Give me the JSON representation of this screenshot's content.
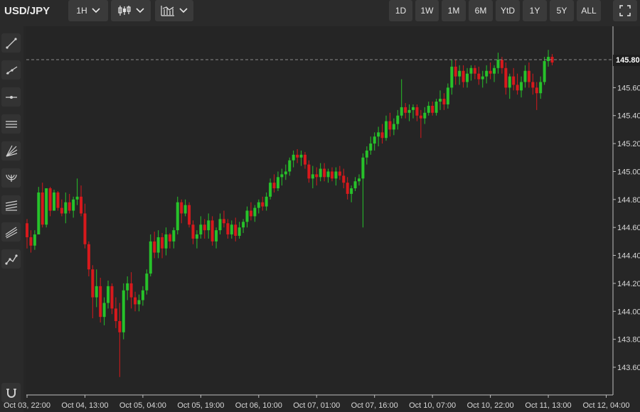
{
  "header": {
    "symbol": "USD/JPY",
    "interval": "1H",
    "ranges": [
      "1D",
      "1W",
      "1M",
      "6M",
      "YtD",
      "1Y",
      "5Y",
      "ALL"
    ]
  },
  "icons": {
    "chart_type": "candlestick-icon",
    "indicators": "indicators-icon",
    "fullscreen": "fullscreen-icon",
    "tools": [
      "trend-line-icon",
      "ray-icon",
      "horizontal-line-icon",
      "parallel-channel-icon",
      "fan-icon",
      "arc-icon",
      "fibonacci-icon",
      "pitchfork-icon",
      "path-icon",
      "magnet-icon"
    ]
  },
  "colors": {
    "up": "#27c22a",
    "down": "#d7191c",
    "background": "#252525"
  },
  "chart_data": {
    "type": "candlestick",
    "symbol": "USD/JPY",
    "y_ticks": [
      "145.80",
      "145.60",
      "145.40",
      "145.20",
      "145.00",
      "144.80",
      "144.60",
      "144.40",
      "144.20",
      "144.00",
      "143.80",
      "143.60"
    ],
    "ylim": [
      143.52,
      146.0
    ],
    "x_tick_labels": [
      "Oct 03, 22:00",
      "Oct 04, 13:00",
      "Oct 05, 04:00",
      "Oct 05, 19:00",
      "Oct 06, 10:00",
      "Oct 07, 01:00",
      "Oct 07, 16:00",
      "Oct 10, 07:00",
      "Oct 10, 22:00",
      "Oct 11, 13:00",
      "Oct 12, 04:00"
    ],
    "x_tick_candle_index": [
      0,
      15,
      30,
      45,
      60,
      75,
      90,
      105,
      120,
      135,
      150
    ],
    "last_price": "145.80",
    "grid": false,
    "candles": [
      [
        144.63,
        144.66,
        144.45,
        144.53
      ],
      [
        144.53,
        144.58,
        144.42,
        144.47
      ],
      [
        144.47,
        144.58,
        144.44,
        144.55
      ],
      [
        144.55,
        144.89,
        144.55,
        144.85
      ],
      [
        144.85,
        144.92,
        144.6,
        144.62
      ],
      [
        144.62,
        144.88,
        144.6,
        144.88
      ],
      [
        144.88,
        144.89,
        144.68,
        144.72
      ],
      [
        144.72,
        144.87,
        144.72,
        144.85
      ],
      [
        144.85,
        144.86,
        144.72,
        144.74
      ],
      [
        144.74,
        144.8,
        144.68,
        144.7
      ],
      [
        144.7,
        144.85,
        144.63,
        144.78
      ],
      [
        144.78,
        144.84,
        144.7,
        144.72
      ],
      [
        144.72,
        144.82,
        144.67,
        144.8
      ],
      [
        144.8,
        144.95,
        144.76,
        144.82
      ],
      [
        144.82,
        144.9,
        144.68,
        144.7
      ],
      [
        144.7,
        144.77,
        144.45,
        144.48
      ],
      [
        144.48,
        144.5,
        144.25,
        144.3
      ],
      [
        144.3,
        144.33,
        143.95,
        144.1
      ],
      [
        144.1,
        144.3,
        144.03,
        144.18
      ],
      [
        144.18,
        144.24,
        143.92,
        143.96
      ],
      [
        143.96,
        144.1,
        143.9,
        144.06
      ],
      [
        144.06,
        144.22,
        144.02,
        144.18
      ],
      [
        144.18,
        144.2,
        143.98,
        144.02
      ],
      [
        144.02,
        144.1,
        143.88,
        143.93
      ],
      [
        143.93,
        144.06,
        143.53,
        143.85
      ],
      [
        143.85,
        144.2,
        143.8,
        144.15
      ],
      [
        144.15,
        144.25,
        144.08,
        144.2
      ],
      [
        144.2,
        144.28,
        144.02,
        144.1
      ],
      [
        144.1,
        144.14,
        144.0,
        144.05
      ],
      [
        144.05,
        144.12,
        144.0,
        144.08
      ],
      [
        144.08,
        144.18,
        144.04,
        144.15
      ],
      [
        144.15,
        144.3,
        144.12,
        144.27
      ],
      [
        144.27,
        144.55,
        144.25,
        144.5
      ],
      [
        144.5,
        144.57,
        144.38,
        144.42
      ],
      [
        144.42,
        144.58,
        144.38,
        144.53
      ],
      [
        144.53,
        144.56,
        144.38,
        144.45
      ],
      [
        144.45,
        144.6,
        144.4,
        144.55
      ],
      [
        144.55,
        144.56,
        144.45,
        144.5
      ],
      [
        144.5,
        144.6,
        144.45,
        144.58
      ],
      [
        144.58,
        144.82,
        144.55,
        144.78
      ],
      [
        144.78,
        144.8,
        144.63,
        144.7
      ],
      [
        144.7,
        144.8,
        144.68,
        144.76
      ],
      [
        144.76,
        144.78,
        144.6,
        144.62
      ],
      [
        144.62,
        144.65,
        144.48,
        144.52
      ],
      [
        144.52,
        144.58,
        144.45,
        144.55
      ],
      [
        144.55,
        144.68,
        144.52,
        144.62
      ],
      [
        144.62,
        144.66,
        144.52,
        144.58
      ],
      [
        144.58,
        144.7,
        144.52,
        144.65
      ],
      [
        144.65,
        144.68,
        144.47,
        144.5
      ],
      [
        144.5,
        144.6,
        144.45,
        144.58
      ],
      [
        144.58,
        144.7,
        144.55,
        144.66
      ],
      [
        144.66,
        144.72,
        144.6,
        144.63
      ],
      [
        144.63,
        144.66,
        144.52,
        144.55
      ],
      [
        144.55,
        144.65,
        144.52,
        144.62
      ],
      [
        144.62,
        144.67,
        144.5,
        144.54
      ],
      [
        144.54,
        144.64,
        144.52,
        144.6
      ],
      [
        144.6,
        144.66,
        144.56,
        144.64
      ],
      [
        144.64,
        144.75,
        144.6,
        144.72
      ],
      [
        144.72,
        144.78,
        144.65,
        144.68
      ],
      [
        144.68,
        144.76,
        144.64,
        144.74
      ],
      [
        144.74,
        144.8,
        144.7,
        144.78
      ],
      [
        144.78,
        144.82,
        144.72,
        144.75
      ],
      [
        144.75,
        144.85,
        144.72,
        144.82
      ],
      [
        144.82,
        144.95,
        144.8,
        144.92
      ],
      [
        144.92,
        144.98,
        144.85,
        144.88
      ],
      [
        144.88,
        145.0,
        144.86,
        144.96
      ],
      [
        144.96,
        145.02,
        144.9,
        144.98
      ],
      [
        144.98,
        145.05,
        144.94,
        145.0
      ],
      [
        145.0,
        145.1,
        144.97,
        145.08
      ],
      [
        145.08,
        145.15,
        145.03,
        145.12
      ],
      [
        145.12,
        145.16,
        145.06,
        145.1
      ],
      [
        145.1,
        145.15,
        145.04,
        145.12
      ],
      [
        145.12,
        145.14,
        145.02,
        145.05
      ],
      [
        145.05,
        145.08,
        144.92,
        144.95
      ],
      [
        144.95,
        145.04,
        144.88,
        144.98
      ],
      [
        144.98,
        145.03,
        144.9,
        144.96
      ],
      [
        144.96,
        145.06,
        144.93,
        145.02
      ],
      [
        145.02,
        145.06,
        144.93,
        144.96
      ],
      [
        144.96,
        145.02,
        144.92,
        145.0
      ],
      [
        145.0,
        145.03,
        144.93,
        144.95
      ],
      [
        144.95,
        145.03,
        144.9,
        145.0
      ],
      [
        145.0,
        145.04,
        144.94,
        144.97
      ],
      [
        144.97,
        145.02,
        144.88,
        144.92
      ],
      [
        144.92,
        144.96,
        144.8,
        144.84
      ],
      [
        144.84,
        144.9,
        144.78,
        144.88
      ],
      [
        144.88,
        144.96,
        144.86,
        144.93
      ],
      [
        144.93,
        144.98,
        144.9,
        144.95
      ],
      [
        144.95,
        145.13,
        144.6,
        145.1
      ],
      [
        145.1,
        145.18,
        145.05,
        145.15
      ],
      [
        145.15,
        145.25,
        145.12,
        145.2
      ],
      [
        145.2,
        145.28,
        145.15,
        145.25
      ],
      [
        145.25,
        145.32,
        145.18,
        145.28
      ],
      [
        145.28,
        145.34,
        145.2,
        145.24
      ],
      [
        145.24,
        145.4,
        145.22,
        145.36
      ],
      [
        145.36,
        145.42,
        145.25,
        145.3
      ],
      [
        145.3,
        145.38,
        145.26,
        145.34
      ],
      [
        145.34,
        145.44,
        145.3,
        145.4
      ],
      [
        145.4,
        145.66,
        145.38,
        145.46
      ],
      [
        145.46,
        145.49,
        145.38,
        145.42
      ],
      [
        145.42,
        145.48,
        145.36,
        145.44
      ],
      [
        145.44,
        145.48,
        145.38,
        145.46
      ],
      [
        145.46,
        145.48,
        145.36,
        145.4
      ],
      [
        145.4,
        145.44,
        145.24,
        145.38
      ],
      [
        145.38,
        145.46,
        145.34,
        145.42
      ],
      [
        145.42,
        145.5,
        145.4,
        145.47
      ],
      [
        145.47,
        145.5,
        145.4,
        145.42
      ],
      [
        145.42,
        145.52,
        145.4,
        145.5
      ],
      [
        145.5,
        145.58,
        145.44,
        145.52
      ],
      [
        145.52,
        145.56,
        145.44,
        145.48
      ],
      [
        145.48,
        145.63,
        145.45,
        145.6
      ],
      [
        145.6,
        145.8,
        145.55,
        145.75
      ],
      [
        145.75,
        145.8,
        145.62,
        145.68
      ],
      [
        145.68,
        145.76,
        145.62,
        145.72
      ],
      [
        145.72,
        145.76,
        145.6,
        145.64
      ],
      [
        145.64,
        145.74,
        145.6,
        145.7
      ],
      [
        145.7,
        145.76,
        145.65,
        145.74
      ],
      [
        145.74,
        145.76,
        145.66,
        145.7
      ],
      [
        145.7,
        145.75,
        145.62,
        145.66
      ],
      [
        145.66,
        145.72,
        145.6,
        145.68
      ],
      [
        145.68,
        145.76,
        145.63,
        145.72
      ],
      [
        145.72,
        145.78,
        145.66,
        145.7
      ],
      [
        145.7,
        145.76,
        145.64,
        145.74
      ],
      [
        145.74,
        145.85,
        145.7,
        145.8
      ],
      [
        145.8,
        145.82,
        145.7,
        145.74
      ],
      [
        145.74,
        145.78,
        145.55,
        145.6
      ],
      [
        145.6,
        145.7,
        145.52,
        145.68
      ],
      [
        145.68,
        145.74,
        145.58,
        145.62
      ],
      [
        145.62,
        145.7,
        145.55,
        145.58
      ],
      [
        145.58,
        145.68,
        145.53,
        145.64
      ],
      [
        145.64,
        145.76,
        145.6,
        145.72
      ],
      [
        145.72,
        145.78,
        145.6,
        145.64
      ],
      [
        145.64,
        145.7,
        145.55,
        145.6
      ],
      [
        145.6,
        145.64,
        145.44,
        145.56
      ],
      [
        145.56,
        145.68,
        145.52,
        145.64
      ],
      [
        145.64,
        145.82,
        145.62,
        145.79
      ],
      [
        145.79,
        145.87,
        145.75,
        145.82
      ],
      [
        145.82,
        145.84,
        145.76,
        145.78
      ]
    ]
  }
}
